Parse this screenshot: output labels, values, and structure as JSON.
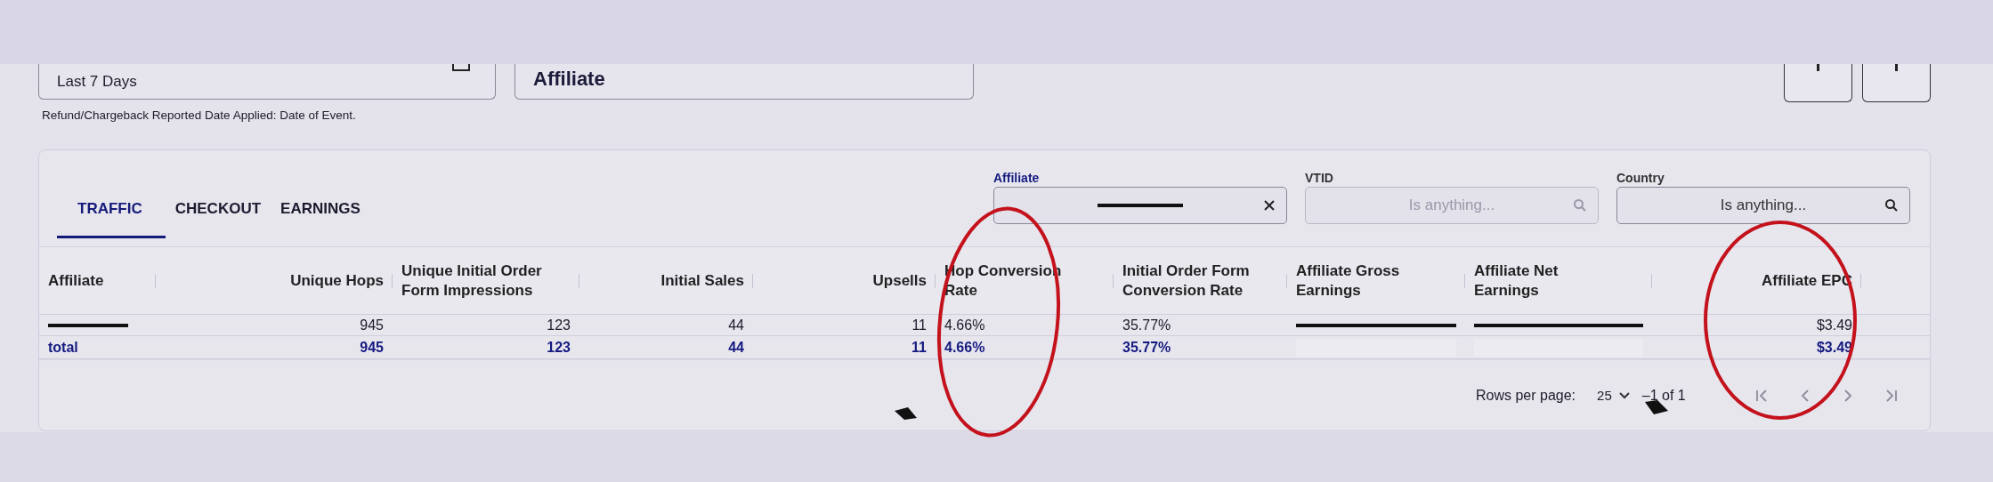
{
  "top_filters": {
    "date_range": "Last 7 Days",
    "report_type": "Affiliate",
    "note": "Refund/Chargeback Reported Date Applied: Date of Event."
  },
  "tabs": [
    {
      "label": "TRAFFIC",
      "selected": true
    },
    {
      "label": "CHECKOUT",
      "selected": false
    },
    {
      "label": "EARNINGS",
      "selected": false
    }
  ],
  "filters": [
    {
      "label": "Affiliate",
      "kind": "clearable",
      "active": true,
      "redacted": true
    },
    {
      "label": "VTID",
      "kind": "search",
      "active": false,
      "placeholder": "Is anything..."
    },
    {
      "label": "Country",
      "kind": "search",
      "active": false,
      "placeholder": "Is anything..."
    }
  ],
  "table": {
    "columns": [
      {
        "label": "Affiliate"
      },
      {
        "label": "Unique Hops"
      },
      {
        "label": "Unique Initial Order Form Impressions"
      },
      {
        "label": "Initial Sales"
      },
      {
        "label": "Upsells"
      },
      {
        "label": "Hop Conversion Rate"
      },
      {
        "label": "Initial Order Form Conversion Rate"
      },
      {
        "label": "Affiliate Gross Earnings"
      },
      {
        "label": "Affiliate Net Earnings"
      },
      {
        "label": "Affiliate EPC"
      }
    ],
    "rows": [
      {
        "kind": "data",
        "cells": [
          {
            "kind": "redacted"
          },
          {
            "text": "945"
          },
          {
            "text": "123"
          },
          {
            "text": "44"
          },
          {
            "text": "11"
          },
          {
            "text": "4.66%"
          },
          {
            "text": "35.77%"
          },
          {
            "kind": "redacted"
          },
          {
            "kind": "redacted"
          },
          {
            "text": "$3.49"
          }
        ]
      },
      {
        "kind": "total",
        "cells": [
          {
            "text": "total"
          },
          {
            "text": "945"
          },
          {
            "text": "123"
          },
          {
            "text": "44"
          },
          {
            "text": "11"
          },
          {
            "text": "4.66%"
          },
          {
            "text": "35.77%"
          },
          {
            "kind": "blank"
          },
          {
            "kind": "blank"
          },
          {
            "text": "$3.49"
          }
        ]
      }
    ]
  },
  "pagination": {
    "rows_per_page_label": "Rows per page:",
    "rows_per_page": "25",
    "range": "–1 of 1",
    "nav": [
      {
        "kind": "first",
        "disabled": true
      },
      {
        "kind": "prev",
        "disabled": true
      },
      {
        "kind": "next",
        "disabled": true
      },
      {
        "kind": "last",
        "disabled": true
      }
    ]
  },
  "annotations": [
    {
      "kind": "circle"
    },
    {
      "kind": "circle"
    }
  ]
}
